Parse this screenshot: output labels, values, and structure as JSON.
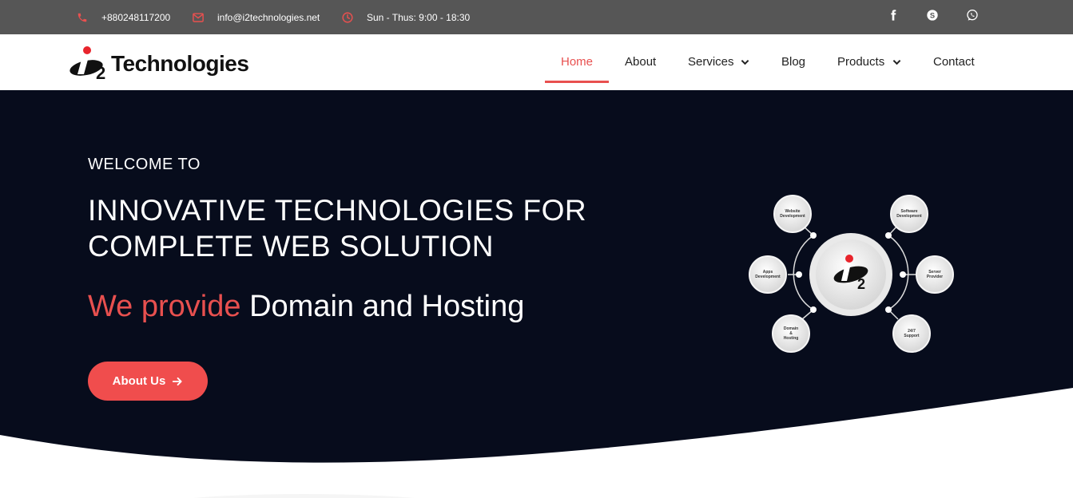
{
  "topbar": {
    "phone": "+880248117200",
    "email": "info@i2technologies.net",
    "hours": "Sun - Thus: 9:00 - 18:30",
    "social_icons": [
      "facebook-icon",
      "skype-icon",
      "whatsapp-icon"
    ]
  },
  "header": {
    "logo_text": "Technologies",
    "nav": [
      {
        "label": "Home",
        "active": true
      },
      {
        "label": "About"
      },
      {
        "label": "Services",
        "dropdown": true
      },
      {
        "label": "Blog"
      },
      {
        "label": "Products",
        "dropdown": true
      },
      {
        "label": "Contact"
      }
    ]
  },
  "hero": {
    "welcome": "WELCOME TO",
    "headline": "INNOVATIVE TECHNOLOGIES FOR COMPLETE WEB SOLUTION",
    "provide_accent": "We provide",
    "provide_text": "Domain and Hosting",
    "button_label": "About Us",
    "diagram_nodes": [
      "Website Development",
      "Software Development",
      "Apps Development",
      "Server Provider",
      "Domain & Hosting",
      "24/7 Support"
    ]
  },
  "colors": {
    "accent": "#e8504f",
    "topbar_bg": "#565656",
    "hero_bg": "#070c1c",
    "button_bg": "#f04d4d"
  }
}
